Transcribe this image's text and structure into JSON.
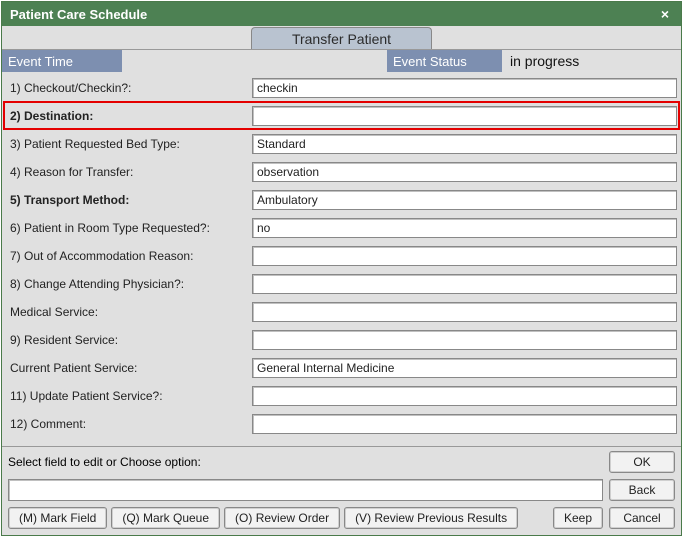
{
  "window": {
    "title": "Patient Care Schedule",
    "close_glyph": "×"
  },
  "tab": {
    "label": "Transfer Patient"
  },
  "status": {
    "event_time_label": "Event Time",
    "event_time_value": "",
    "event_status_label": "Event Status",
    "event_status_value": "in progress"
  },
  "rows": [
    {
      "label": "1)  Checkout/Checkin?:",
      "value": "checkin",
      "bold": false,
      "highlight": false
    },
    {
      "label": "2)  Destination:",
      "value": "",
      "bold": true,
      "highlight": true
    },
    {
      "label": "3)  Patient Requested Bed Type:",
      "value": "Standard",
      "bold": false,
      "highlight": false
    },
    {
      "label": "4)  Reason for Transfer:",
      "value": "observation",
      "bold": false,
      "highlight": false
    },
    {
      "label": "5)  Transport Method:",
      "value": "Ambulatory",
      "bold": true,
      "highlight": false
    },
    {
      "label": "6)  Patient in Room Type Requested?:",
      "value": "no",
      "bold": false,
      "highlight": false
    },
    {
      "label": "7)  Out of Accommodation Reason:",
      "value": "",
      "bold": false,
      "highlight": false
    },
    {
      "label": "8)  Change Attending Physician?:",
      "value": "",
      "bold": false,
      "highlight": false
    },
    {
      "label": "      Medical Service:",
      "value": "",
      "bold": false,
      "highlight": false
    },
    {
      "label": "9)  Resident Service:",
      "value": "",
      "bold": false,
      "highlight": false
    },
    {
      "label": "      Current Patient Service:",
      "value": "General Internal Medicine",
      "bold": false,
      "highlight": false
    },
    {
      "label": "11)  Update Patient Service?:",
      "value": "",
      "bold": false,
      "highlight": false
    },
    {
      "label": "12)  Comment:",
      "value": "",
      "bold": false,
      "highlight": false
    }
  ],
  "footer": {
    "prompt": "Select field to edit or Choose option:",
    "ok": "OK",
    "back": "Back",
    "cancel": "Cancel",
    "keep": "Keep",
    "mark_field": "(M) Mark Field",
    "mark_queue": "(Q) Mark Queue",
    "review_order": "(O) Review Order",
    "review_prev": "(V) Review Previous Results"
  }
}
